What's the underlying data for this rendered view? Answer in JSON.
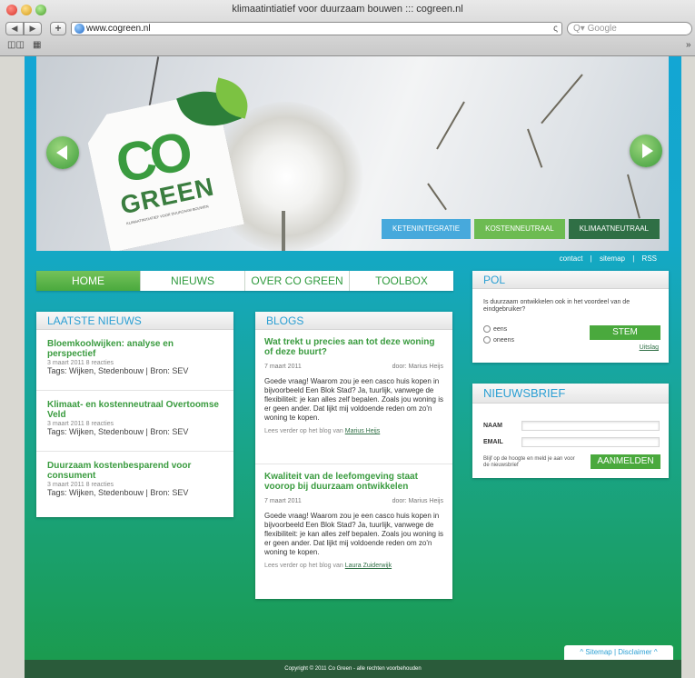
{
  "browser": {
    "window_title": "klimaatintiatief voor duurzaam bouwen ::: cogreen.nl",
    "url": "www.cogreen.nl",
    "search_placeholder": "Google",
    "back_glyph": "◀",
    "forward_glyph": "▶",
    "add_glyph": "+",
    "reload_glyph": "ς",
    "search_glyph": "Q▾"
  },
  "hero": {
    "logo_co": "CO",
    "logo_green": "GREEN",
    "logo_sub": "KLIMAATINITIATIEF VOOR DUURZAAM BOUWEN",
    "tabs": [
      "KETENINTEGRATIE",
      "KOSTENNEUTRAAL",
      "KLIMAATNEUTRAAL"
    ]
  },
  "toplinks": {
    "contact": "contact",
    "sitemap": "sitemap",
    "rss": "RSS",
    "sep": "|"
  },
  "nav": {
    "items": [
      "HOME",
      "NIEUWS",
      "OVER CO GREEN",
      "TOOLBOX"
    ]
  },
  "news": {
    "title": "LAATSTE NIEUWS",
    "items": [
      {
        "title": "Bloemkoolwijken: analyse en perspectief",
        "meta": "3 maart 2011   8 reacties",
        "tags": "Tags: Wijken, Stedenbouw | Bron: SEV"
      },
      {
        "title": "Klimaat- en kostenneutraal Overtoomse Veld",
        "meta": "3 maart 2011   8 reacties",
        "tags": "Tags: Wijken, Stedenbouw | Bron: SEV"
      },
      {
        "title": "Duurzaam kostenbesparend voor consument",
        "meta": "3 maart 2011   8 reacties",
        "tags": "Tags: Wijken, Stedenbouw | Bron: SEV"
      }
    ]
  },
  "blogs": {
    "title": "BLOGS",
    "items": [
      {
        "title": "Wat trekt u precies aan tot deze woning of deze buurt?",
        "date": "7 maart 2011",
        "author": "door: Marius Heijs",
        "text": "Goede vraag! Waarom zou je een casco huis kopen in bijvoorbeeld Een Blok Stad? Ja, tuurlijk, vanwege de flexibiliteit: je kan alles zelf bepalen. Zoals jou woning is er geen ander. Dat lijkt mij voldoende reden om zo'n woning te kopen.",
        "more_prefix": "Lees verder op het blog van ",
        "more_link": "Marius Heijs"
      },
      {
        "title": "Kwaliteit van de leefomgeving staat voorop bij duurzaam ontwikkelen",
        "date": "7 maart 2011",
        "author": "door: Marius Heijs",
        "text": "Goede vraag! Waarom zou je een casco huis kopen in bijvoorbeeld Een Blok Stad? Ja, tuurlijk, vanwege de flexibiliteit: je kan alles zelf bepalen. Zoals jou woning is er geen ander. Dat lijkt mij voldoende reden om zo'n woning te kopen.",
        "more_prefix": "Lees verder op het blog van ",
        "more_link": "Laura Zuiderwijk"
      }
    ]
  },
  "pol": {
    "title": "POL",
    "question": "Is duurzaam ontwikkelen ook in het voordeel van de eindgebruiker?",
    "options": [
      "eens",
      "oneens"
    ],
    "vote_label": "STEM",
    "result_link": "Uitslag"
  },
  "newsletter": {
    "title": "NIEUWSBRIEF",
    "name_label": "NAAM",
    "email_label": "EMAIL",
    "note": "Blijf op de hoogte en meld je aan voor de nieuwsbrief",
    "submit_label": "AANMELDEN"
  },
  "footer": {
    "links": "^  Sitemap  |  Disclaimer  ^",
    "copyright": "Copyright © 2011 Co Green - alle rechten voorbehouden"
  }
}
